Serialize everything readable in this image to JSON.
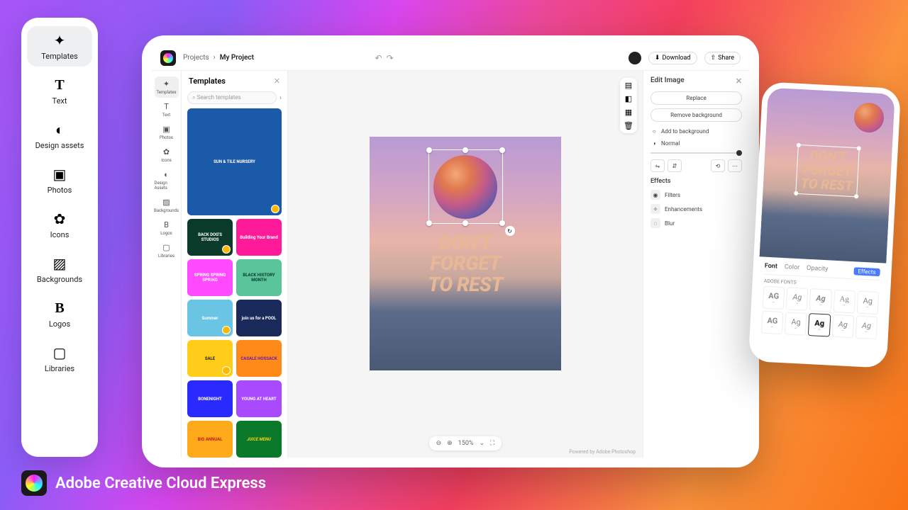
{
  "brand": "Adobe Creative Cloud Express",
  "left_nav": [
    {
      "label": "Templates",
      "icon": "✦"
    },
    {
      "label": "Text",
      "icon": "T"
    },
    {
      "label": "Design assets",
      "icon": "◐"
    },
    {
      "label": "Photos",
      "icon": "▣"
    },
    {
      "label": "Icons",
      "icon": "✿"
    },
    {
      "label": "Backgrounds",
      "icon": "▨"
    },
    {
      "label": "Logos",
      "icon": "B"
    },
    {
      "label": "Libraries",
      "icon": "▢"
    }
  ],
  "breadcrumb": {
    "root": "Projects",
    "current": "My Project"
  },
  "topbar": {
    "download": "Download",
    "share": "Share"
  },
  "rail": [
    {
      "label": "Templates",
      "icon": "✦"
    },
    {
      "label": "Text",
      "icon": "T"
    },
    {
      "label": "Photos",
      "icon": "▣"
    },
    {
      "label": "Icons",
      "icon": "✿"
    },
    {
      "label": "Design Assets",
      "icon": "◐"
    },
    {
      "label": "Backgrounds",
      "icon": "▨"
    },
    {
      "label": "Logos",
      "icon": "B"
    },
    {
      "label": "Libraries",
      "icon": "▢"
    }
  ],
  "templates": {
    "title": "Templates",
    "search_placeholder": "Search templates",
    "cards": [
      {
        "text": "SUN & TILE NURSERY",
        "bg": "#1a5aa8"
      },
      {
        "text": "BACK DOG'S STUDIOS",
        "bg": "#0a3a2a"
      },
      {
        "text": "Building Your Brand",
        "bg": "#ff1a9a"
      },
      {
        "text": "SPRING SPRING SPRING",
        "bg": "#ff4aff"
      },
      {
        "text": "BLACK HISTORY MONTH",
        "bg": "#5ac49a"
      },
      {
        "text": "Summer",
        "bg": "#6ac4e4"
      },
      {
        "text": "join us for a POOL",
        "bg": "#1a2a5a"
      },
      {
        "text": "SALE",
        "bg": "#ffcc1a"
      },
      {
        "text": "CASALE HOSSACK",
        "bg": "#ff8a1a"
      },
      {
        "text": "BONENIGHT",
        "bg": "#2a2aff"
      },
      {
        "text": "YOUNG AT HEART",
        "bg": "#aa4aff"
      },
      {
        "text": "BIG ANNUAL",
        "bg": "#ffaa1a"
      },
      {
        "text": "JUICE MENU",
        "bg": "#0a7a2a"
      }
    ]
  },
  "canvas": {
    "slogan_l1": "DON'T",
    "slogan_l2": "FORGET",
    "slogan_l3": "TO REST",
    "zoom": "150%"
  },
  "edit": {
    "title": "Edit Image",
    "replace": "Replace",
    "remove_bg": "Remove background",
    "add_bg": "Add to background",
    "blend": "Normal",
    "effects": "Effects",
    "filters": "Filters",
    "enhance": "Enhancements",
    "blur": "Blur",
    "powered": "Powered by Adobe Photoshop"
  },
  "phone": {
    "tabs": {
      "font": "Font",
      "color": "Color",
      "opacity": "Opacity",
      "effects": "Effects"
    },
    "fonts_label": "ADOBE FONTS"
  }
}
